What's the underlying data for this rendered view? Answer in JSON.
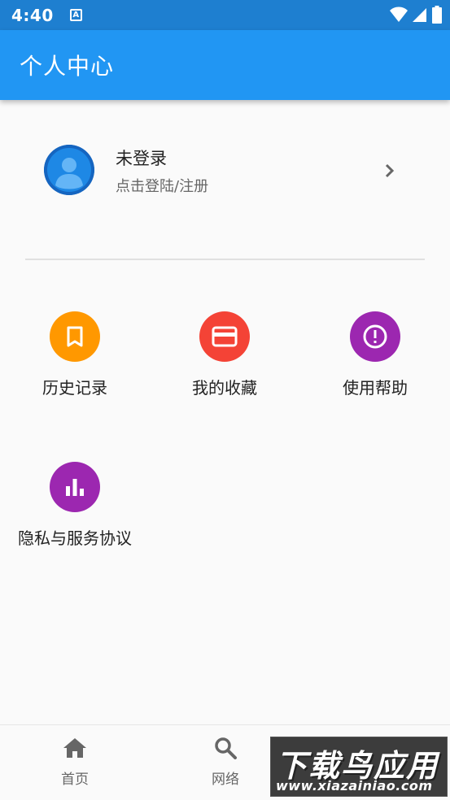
{
  "status_bar": {
    "time": "4:40",
    "app_icon_letter": "A",
    "icons": [
      "wifi-icon",
      "signal-icon",
      "battery-icon"
    ]
  },
  "app_bar": {
    "title": "个人中心",
    "color": "#2196f3"
  },
  "profile": {
    "name": "未登录",
    "subtitle": "点击登陆/注册",
    "avatar_icon": "person-avatar-icon"
  },
  "menu": [
    {
      "label": "历史记录",
      "icon": "bookmark-icon",
      "color": "#ff9800"
    },
    {
      "label": "我的收藏",
      "icon": "credit-card-icon",
      "color": "#f44336"
    },
    {
      "label": "使用帮助",
      "icon": "exclamation-circle-icon",
      "color": "#9c27b0"
    },
    {
      "label": "隐私与服务协议",
      "icon": "bar-chart-icon",
      "color": "#9c27b0"
    }
  ],
  "bottom_nav": [
    {
      "label": "首页",
      "icon": "home-icon"
    },
    {
      "label": "网络",
      "icon": "search-icon"
    }
  ],
  "watermark": {
    "title": "下载鸟应用",
    "url": "www.xiazainiao.com"
  }
}
